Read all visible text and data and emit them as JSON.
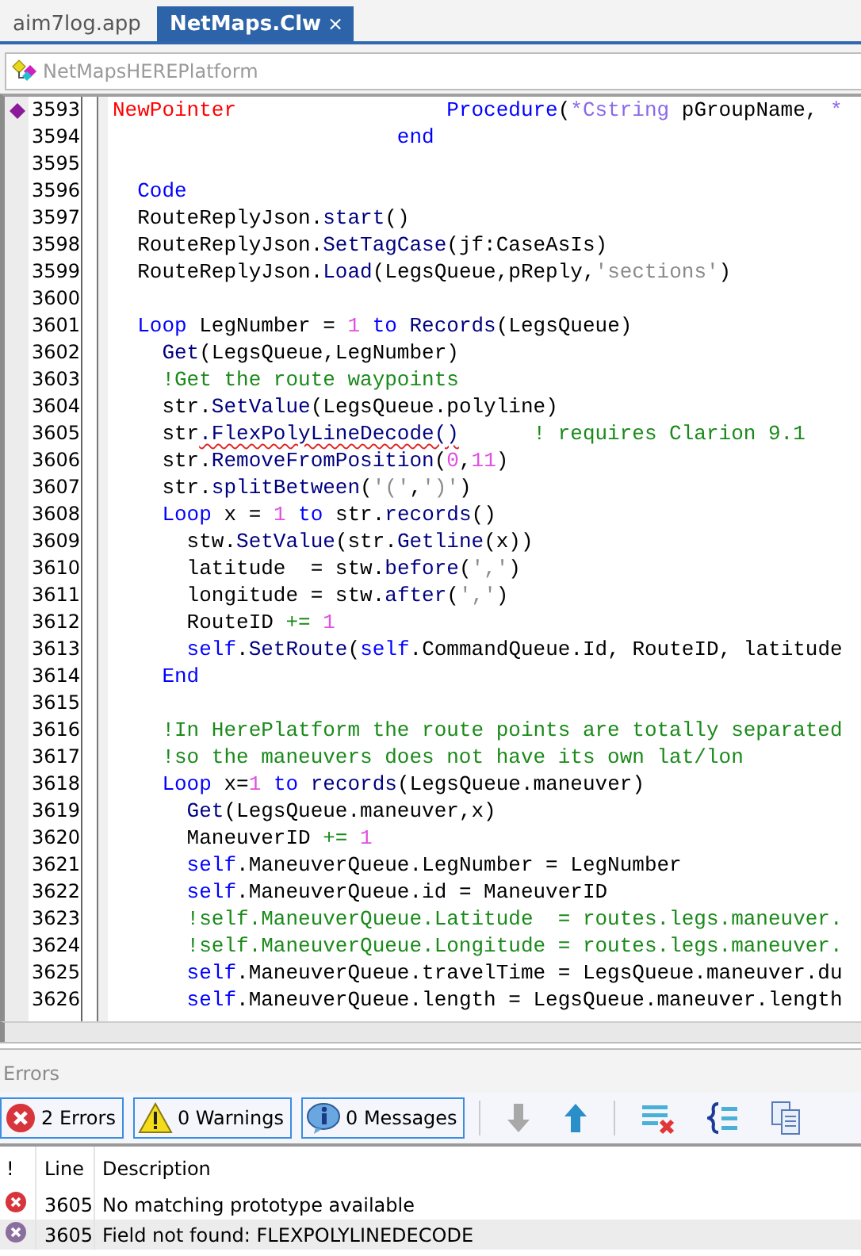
{
  "tabs": [
    {
      "label": "aim7log.app",
      "selected": false
    },
    {
      "label": "NetMaps.Clw",
      "selected": true,
      "close": "×"
    }
  ],
  "breadcrumb": {
    "text": "NetMapsHEREPlatform"
  },
  "editor": {
    "lines": [
      {
        "number": "3593",
        "marker": true,
        "tokens": [
          {
            "kind": "red",
            "text": "NewPointer"
          },
          {
            "kind": "kw",
            "text": "                 Procedure"
          },
          {
            "kind": "plain",
            "text": "("
          },
          {
            "kind": "type",
            "text": "*Cstring"
          },
          {
            "kind": "plain",
            "text": " pGroupName, "
          },
          {
            "kind": "type",
            "text": "*"
          }
        ]
      },
      {
        "number": "3594",
        "marker": false,
        "tokens": [
          {
            "kind": "kw",
            "text": "                       end"
          }
        ]
      },
      {
        "number": "3595",
        "marker": false
      },
      {
        "number": "3596",
        "marker": false,
        "tokens": [
          {
            "kind": "kw",
            "text": "  Code"
          }
        ]
      },
      {
        "number": "3597",
        "marker": false,
        "tokens": [
          {
            "kind": "plain",
            "text": "  RouteReplyJson."
          },
          {
            "kind": "fn",
            "text": "start"
          },
          {
            "kind": "plain",
            "text": "()"
          }
        ]
      },
      {
        "number": "3598",
        "marker": false,
        "tokens": [
          {
            "kind": "plain",
            "text": "  RouteReplyJson."
          },
          {
            "kind": "fn",
            "text": "SetTagCase"
          },
          {
            "kind": "plain",
            "text": "(jf:CaseAsIs)"
          }
        ]
      },
      {
        "number": "3599",
        "marker": false,
        "tokens": [
          {
            "kind": "plain",
            "text": "  RouteReplyJson."
          },
          {
            "kind": "fn",
            "text": "Load"
          },
          {
            "kind": "plain",
            "text": "(LegsQueue,pReply,"
          },
          {
            "kind": "str",
            "text": "'sections'"
          },
          {
            "kind": "plain",
            "text": ")"
          }
        ]
      },
      {
        "number": "3600",
        "marker": false
      },
      {
        "number": "3601",
        "marker": false,
        "tokens": [
          {
            "kind": "kw",
            "text": "  Loop"
          },
          {
            "kind": "plain",
            "text": " LegNumber = "
          },
          {
            "kind": "num",
            "text": "1"
          },
          {
            "kind": "kw",
            "text": " to"
          },
          {
            "kind": "fn",
            "text": " Records"
          },
          {
            "kind": "plain",
            "text": "(LegsQueue)"
          }
        ]
      },
      {
        "number": "3602",
        "marker": false,
        "tokens": [
          {
            "kind": "fn",
            "text": "    Get"
          },
          {
            "kind": "plain",
            "text": "(LegsQueue,LegNumber)"
          }
        ]
      },
      {
        "number": "3603",
        "marker": false,
        "tokens": [
          {
            "kind": "cmt",
            "text": "    !Get the route waypoints"
          }
        ]
      },
      {
        "number": "3604",
        "marker": false,
        "tokens": [
          {
            "kind": "plain",
            "text": "    str."
          },
          {
            "kind": "fn",
            "text": "SetValue"
          },
          {
            "kind": "plain",
            "text": "(LegsQueue.polyline)"
          }
        ]
      },
      {
        "number": "3605",
        "marker": false,
        "tokens": [
          {
            "kind": "plain",
            "text": "    str"
          },
          {
            "kind": "err",
            "text": ".FlexPolyLineDecode()"
          },
          {
            "kind": "cmt",
            "text": "      ! requires Clarion 9.1"
          }
        ]
      },
      {
        "number": "3606",
        "marker": false,
        "tokens": [
          {
            "kind": "plain",
            "text": "    str."
          },
          {
            "kind": "fn",
            "text": "RemoveFromPosition"
          },
          {
            "kind": "plain",
            "text": "("
          },
          {
            "kind": "num",
            "text": "0"
          },
          {
            "kind": "plain",
            "text": ","
          },
          {
            "kind": "num",
            "text": "11"
          },
          {
            "kind": "plain",
            "text": ")"
          }
        ]
      },
      {
        "number": "3607",
        "marker": false,
        "tokens": [
          {
            "kind": "plain",
            "text": "    str."
          },
          {
            "kind": "fn",
            "text": "splitBetween"
          },
          {
            "kind": "plain",
            "text": "("
          },
          {
            "kind": "str",
            "text": "'('"
          },
          {
            "kind": "plain",
            "text": ","
          },
          {
            "kind": "str",
            "text": "')'"
          },
          {
            "kind": "plain",
            "text": ")"
          }
        ]
      },
      {
        "number": "3608",
        "marker": false,
        "tokens": [
          {
            "kind": "kw",
            "text": "    Loop"
          },
          {
            "kind": "plain",
            "text": " x = "
          },
          {
            "kind": "num",
            "text": "1"
          },
          {
            "kind": "kw",
            "text": " to"
          },
          {
            "kind": "plain",
            "text": " str."
          },
          {
            "kind": "fn",
            "text": "records"
          },
          {
            "kind": "plain",
            "text": "()"
          }
        ]
      },
      {
        "number": "3609",
        "marker": false,
        "tokens": [
          {
            "kind": "plain",
            "text": "      stw."
          },
          {
            "kind": "fn",
            "text": "SetValue"
          },
          {
            "kind": "plain",
            "text": "(str."
          },
          {
            "kind": "fn",
            "text": "Getline"
          },
          {
            "kind": "plain",
            "text": "(x))"
          }
        ]
      },
      {
        "number": "3610",
        "marker": false,
        "tokens": [
          {
            "kind": "plain",
            "text": "      latitude  = stw."
          },
          {
            "kind": "fn",
            "text": "before"
          },
          {
            "kind": "plain",
            "text": "("
          },
          {
            "kind": "str",
            "text": "','"
          },
          {
            "kind": "plain",
            "text": ")"
          }
        ]
      },
      {
        "number": "3611",
        "marker": false,
        "tokens": [
          {
            "kind": "plain",
            "text": "      longitude = stw."
          },
          {
            "kind": "fn",
            "text": "after"
          },
          {
            "kind": "plain",
            "text": "("
          },
          {
            "kind": "str",
            "text": "','"
          },
          {
            "kind": "plain",
            "text": ")"
          }
        ]
      },
      {
        "number": "3612",
        "marker": false,
        "tokens": [
          {
            "kind": "plain",
            "text": "      RouteID"
          },
          {
            "kind": "op",
            "text": " +="
          },
          {
            "kind": "num",
            "text": " 1"
          }
        ]
      },
      {
        "number": "3613",
        "marker": false,
        "tokens": [
          {
            "kind": "kw",
            "text": "      self"
          },
          {
            "kind": "plain",
            "text": "."
          },
          {
            "kind": "fn",
            "text": "SetRoute"
          },
          {
            "kind": "plain",
            "text": "("
          },
          {
            "kind": "kw",
            "text": "self"
          },
          {
            "kind": "plain",
            "text": ".CommandQueue.Id, RouteID, latitude"
          }
        ]
      },
      {
        "number": "3614",
        "marker": false,
        "tokens": [
          {
            "kind": "kw",
            "text": "    End"
          }
        ]
      },
      {
        "number": "3615",
        "marker": false
      },
      {
        "number": "3616",
        "marker": false,
        "tokens": [
          {
            "kind": "cmt",
            "text": "    !In HerePlatform the route points are totally separated"
          }
        ]
      },
      {
        "number": "3617",
        "marker": false,
        "tokens": [
          {
            "kind": "cmt",
            "text": "    !so the maneuvers does not have its own lat/lon"
          }
        ]
      },
      {
        "number": "3618",
        "marker": false,
        "tokens": [
          {
            "kind": "kw",
            "text": "    Loop"
          },
          {
            "kind": "plain",
            "text": " x="
          },
          {
            "kind": "num",
            "text": "1"
          },
          {
            "kind": "kw",
            "text": " to"
          },
          {
            "kind": "fn",
            "text": " records"
          },
          {
            "kind": "plain",
            "text": "(LegsQueue.maneuver)"
          }
        ]
      },
      {
        "number": "3619",
        "marker": false,
        "tokens": [
          {
            "kind": "fn",
            "text": "      Get"
          },
          {
            "kind": "plain",
            "text": "(LegsQueue.maneuver,x)"
          }
        ]
      },
      {
        "number": "3620",
        "marker": false,
        "tokens": [
          {
            "kind": "plain",
            "text": "      ManeuverID"
          },
          {
            "kind": "op",
            "text": " +="
          },
          {
            "kind": "num",
            "text": " 1"
          }
        ]
      },
      {
        "number": "3621",
        "marker": false,
        "tokens": [
          {
            "kind": "kw",
            "text": "      self"
          },
          {
            "kind": "plain",
            "text": ".ManeuverQueue.LegNumber = LegNumber"
          }
        ]
      },
      {
        "number": "3622",
        "marker": false,
        "tokens": [
          {
            "kind": "kw",
            "text": "      self"
          },
          {
            "kind": "plain",
            "text": ".ManeuverQueue.id = ManeuverID"
          }
        ]
      },
      {
        "number": "3623",
        "marker": false,
        "tokens": [
          {
            "kind": "cmt",
            "text": "      !self.ManeuverQueue.Latitude  = routes.legs.maneuver."
          }
        ]
      },
      {
        "number": "3624",
        "marker": false,
        "tokens": [
          {
            "kind": "cmt",
            "text": "      !self.ManeuverQueue.Longitude = routes.legs.maneuver."
          }
        ]
      },
      {
        "number": "3625",
        "marker": false,
        "tokens": [
          {
            "kind": "kw",
            "text": "      self"
          },
          {
            "kind": "plain",
            "text": ".ManeuverQueue.travelTime = LegsQueue.maneuver.du"
          }
        ]
      },
      {
        "number": "3626",
        "marker": false,
        "tokens": [
          {
            "kind": "kw",
            "text": "      self"
          },
          {
            "kind": "plain",
            "text": ".ManeuverQueue.length = LegsQueue.maneuver.length"
          }
        ]
      }
    ]
  },
  "errors_panel": {
    "title": "Errors",
    "filters": [
      {
        "kind": "error",
        "label": "2 Errors",
        "selected": true
      },
      {
        "kind": "warning",
        "label": "0 Warnings",
        "selected": true
      },
      {
        "kind": "info",
        "label": "0 Messages",
        "selected": true
      }
    ],
    "tools": [
      {
        "kind": "down",
        "disabled": true
      },
      {
        "kind": "up",
        "disabled": false
      },
      {
        "kind": "clear",
        "disabled": false
      },
      {
        "kind": "braces",
        "disabled": false
      },
      {
        "kind": "copy",
        "disabled": false
      }
    ],
    "columns": [
      "!",
      "Line",
      "Description"
    ],
    "rows": [
      {
        "color": "#d8343c",
        "line": "3605",
        "description": "No matching prototype available",
        "selected": false
      },
      {
        "color": "#8a6f9e",
        "line": "3605",
        "description": "Field not found: FLEXPOLYLINEDECODE",
        "selected": true
      }
    ]
  }
}
